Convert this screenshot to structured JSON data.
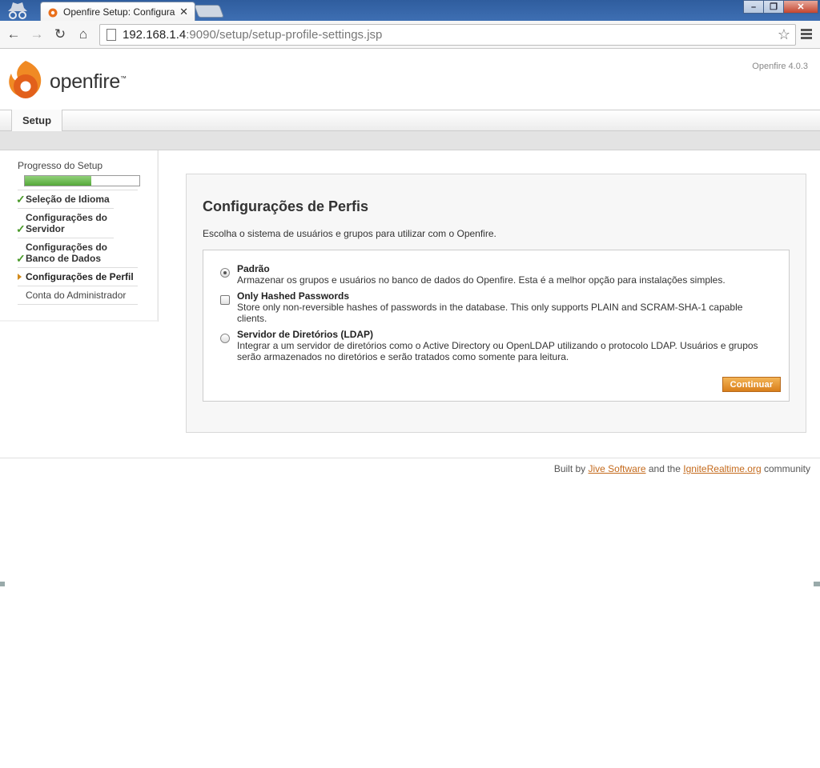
{
  "browser": {
    "tab_title": "Openfire Setup: Configura",
    "tab_close": "✕",
    "url_host": "192.168.1.4",
    "url_rest": ":9090/setup/setup-profile-settings.jsp",
    "window_controls": [
      "minimize-icon",
      "restore-icon",
      "close-icon"
    ]
  },
  "header": {
    "logo_text": "openfire",
    "logo_tm": "™",
    "version": "Openfire 4.0.3"
  },
  "nav": {
    "tab": "Setup"
  },
  "sidebar": {
    "progress_title": "Progresso do Setup",
    "progress_percent": 58,
    "steps": [
      {
        "label": "Seleção de Idioma",
        "state": "done"
      },
      {
        "label": "Configurações do Servidor",
        "state": "done"
      },
      {
        "label": "Configurações do Banco de Dados",
        "state": "done"
      },
      {
        "label": "Configurações de Perfil",
        "state": "current"
      },
      {
        "label": "Conta do Administrador",
        "state": "pending"
      }
    ],
    "check_glyph": "✓"
  },
  "main": {
    "title": "Configurações de Perfis",
    "intro": "Escolha o sistema de usuários e grupos para utilizar com o Openfire.",
    "options": [
      {
        "label": "Padrão",
        "desc": "Armazenar os grupos e usuários no banco de dados do Openfire. Esta é a melhor opção para instalações simples.",
        "checked": true
      },
      {
        "label": "Only Hashed Passwords",
        "desc": "Store only non-reversible hashes of passwords in the database. This only supports PLAIN and SCRAM-SHA-1 capable clients.",
        "checked": false
      },
      {
        "label": "Servidor de Diretórios (LDAP)",
        "desc": "Integrar a um servidor de diretórios como o Active Directory ou OpenLDAP utilizando o protocolo LDAP. Usuários e grupos serão armazenados no diretórios e serão tratados como somente para leitura.",
        "checked": false
      }
    ],
    "continue_label": "Continuar"
  },
  "footer": {
    "prefix": "Built by ",
    "link1": "Jive Software",
    "middle": " and the ",
    "link2": "IgniteRealtime.org",
    "suffix": " community"
  },
  "colors": {
    "accent": "#d97f1b",
    "progress": "#54a83a",
    "link": "#c46a1c"
  }
}
